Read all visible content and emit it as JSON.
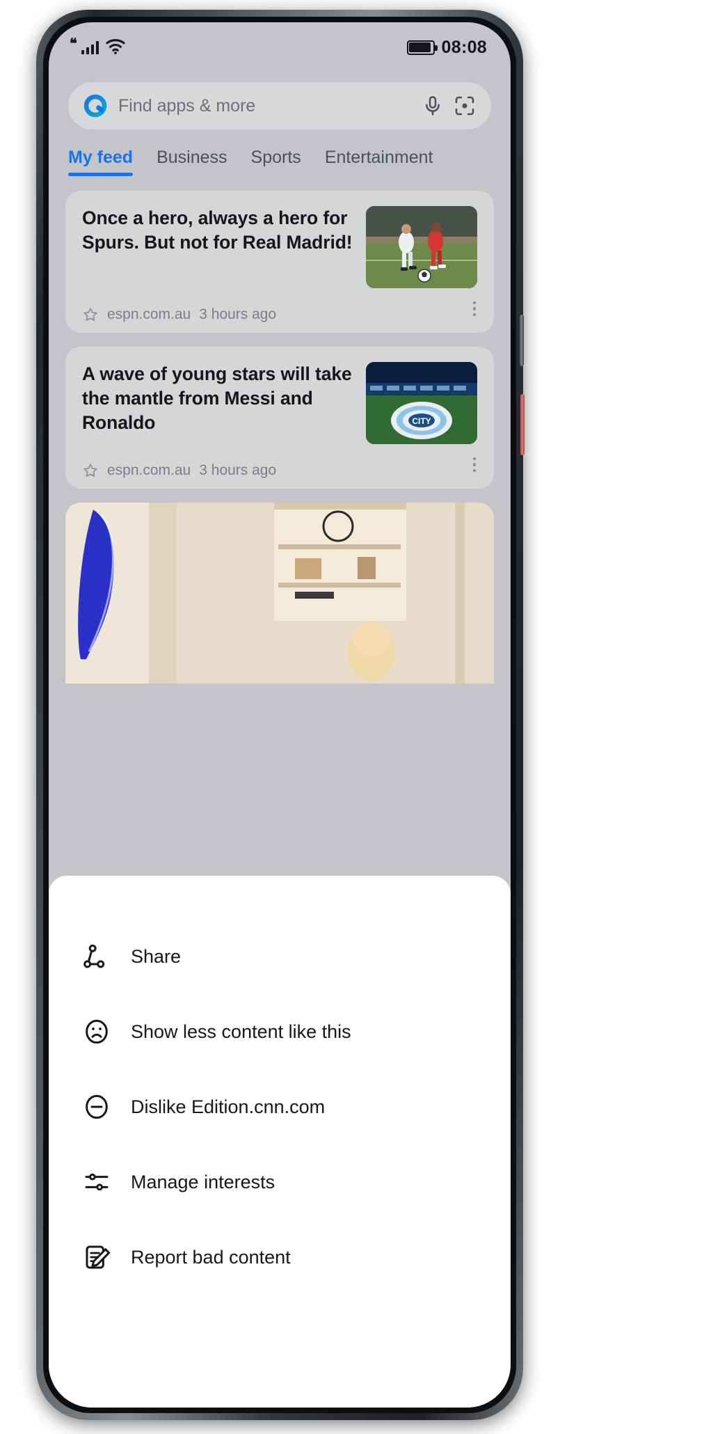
{
  "status_bar": {
    "quote_glyph": "❝",
    "signal_icon": "signal-bars-icon",
    "wifi_icon": "wifi-icon",
    "battery_icon": "battery-icon",
    "time": "08:08"
  },
  "search": {
    "logo_icon": "assistant-logo-icon",
    "placeholder": "Find apps & more",
    "mic_icon": "microphone-icon",
    "lens_icon": "lens-scan-icon"
  },
  "tabs": [
    {
      "label": "My feed",
      "active": true
    },
    {
      "label": "Business",
      "active": false
    },
    {
      "label": "Sports",
      "active": false
    },
    {
      "label": "Entertainment",
      "active": false
    }
  ],
  "feed": {
    "cards": [
      {
        "headline": "Once a hero, always a hero for Spurs. But not for Real Madrid!",
        "source": "espn.com.au",
        "time_ago": "3 hours ago",
        "thumb_alt": "soccer-players-photo"
      },
      {
        "headline": "A wave of young stars will take the mantle from Messi and Ronaldo",
        "source": "espn.com.au",
        "time_ago": "3 hours ago",
        "thumb_alt": "manchester-city-stadium-photo"
      }
    ],
    "wide_card_alt": "interior-room-photo"
  },
  "sheet": {
    "items": [
      {
        "label": "Share",
        "icon": "share-icon"
      },
      {
        "label": "Show less content like this",
        "icon": "sad-face-icon"
      },
      {
        "label": "Dislike Edition.cnn.com",
        "icon": "minus-circle-icon"
      },
      {
        "label": "Manage interests",
        "icon": "sliders-icon"
      },
      {
        "label": "Report bad content",
        "icon": "report-note-icon"
      }
    ]
  },
  "colors": {
    "accent": "#1a73e8",
    "screen_bg": "#c3c5c8",
    "card_bg": "#d5d6d8",
    "sheet_bg": "#ffffff",
    "text_primary": "#14161a",
    "text_muted": "#7b7e82"
  }
}
